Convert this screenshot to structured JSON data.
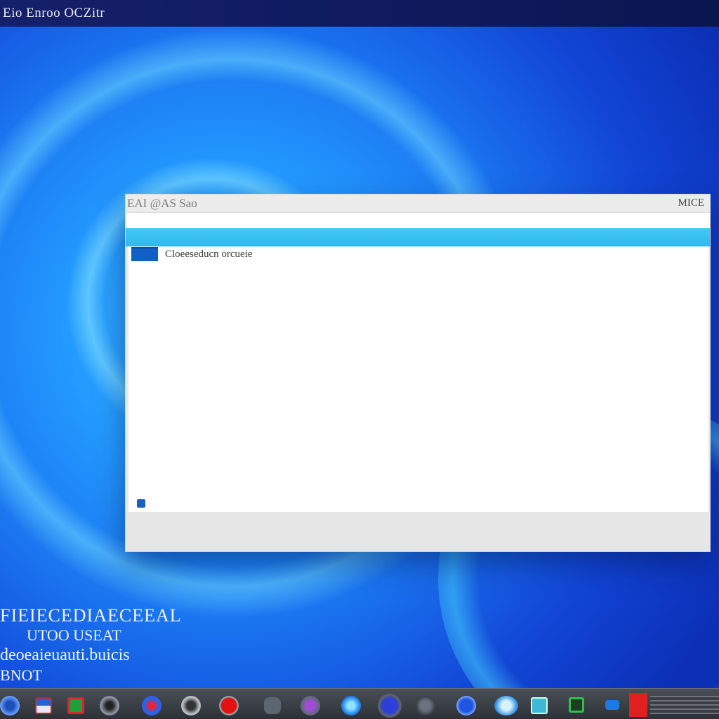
{
  "desktop": {
    "topbar_title": "Eio Enroo OCZitr",
    "text_lines": [
      "FIEIECEDIAECEEAL",
      "UTOO USEAT",
      "deoeaieuauti.buicis",
      "BNOT"
    ]
  },
  "window": {
    "title": "EAI @AS Sao",
    "controls": "MICE",
    "content_item_label": "Cloeeseducn orcueie"
  },
  "taskbar": {
    "icons": [
      "start-icon",
      "app-icon",
      "app-icon",
      "app-icon",
      "app-icon",
      "app-icon",
      "app-icon",
      "app-icon",
      "app-icon",
      "app-icon",
      "app-icon",
      "app-icon",
      "app-icon",
      "app-icon",
      "app-icon",
      "app-icon",
      "app-icon",
      "app-icon"
    ]
  }
}
